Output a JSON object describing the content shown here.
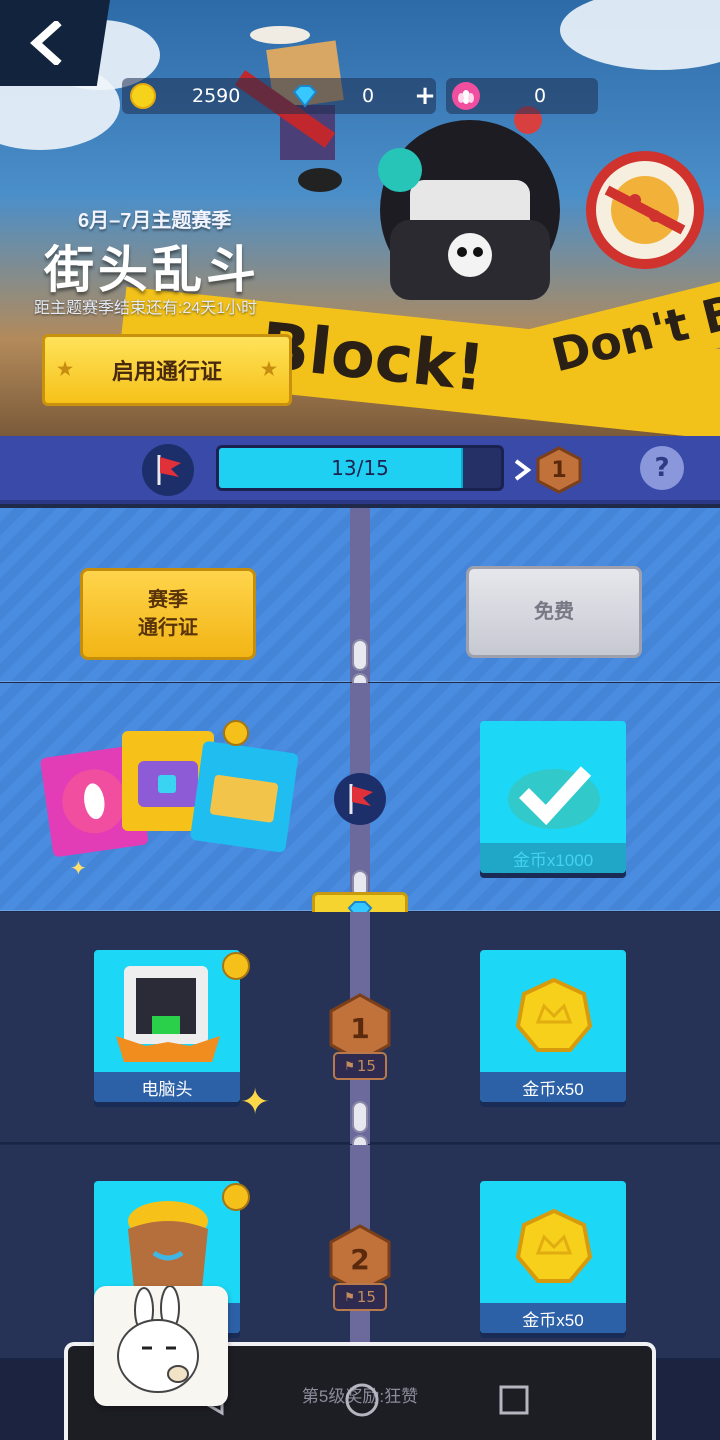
{
  "header": {
    "back_icon": "chevron-left-icon",
    "coins": "2590",
    "gems": "0",
    "gem_plus": "+",
    "tokens": "0",
    "season_subtitle": "6月–7月主题赛季",
    "season_title": "街头乱斗",
    "season_remaining": "距主题赛季结束还有:24天1小时",
    "activate_pass_label": "启用通行证",
    "tape_text_1": "Block!",
    "tape_text_2": "Don't B"
  },
  "progress": {
    "current": 13,
    "max": 15,
    "text": "13/15",
    "next_level": "1",
    "arrow": ">",
    "help": "?"
  },
  "tracks": {
    "pass_ticket": "赛季\n通行证",
    "pass_ticket_line1": "赛季",
    "pass_ticket_line2": "通行证",
    "free_ticket": "免费",
    "claimed_reward_label": "金币x1000"
  },
  "levels": [
    {
      "number": "1",
      "flags": "15",
      "premium_label": "电脑头",
      "free_label": "金币x50"
    },
    {
      "number": "2",
      "flags": "15",
      "premium_label": "",
      "free_label": "金币x50"
    }
  ],
  "bottom": {
    "next_reward_text": "第5级奖励:狂赞"
  },
  "colors": {
    "accent_cyan": "#1cd7f5",
    "gold": "#f6c21a",
    "bar_blue": "#3a4aa8"
  }
}
